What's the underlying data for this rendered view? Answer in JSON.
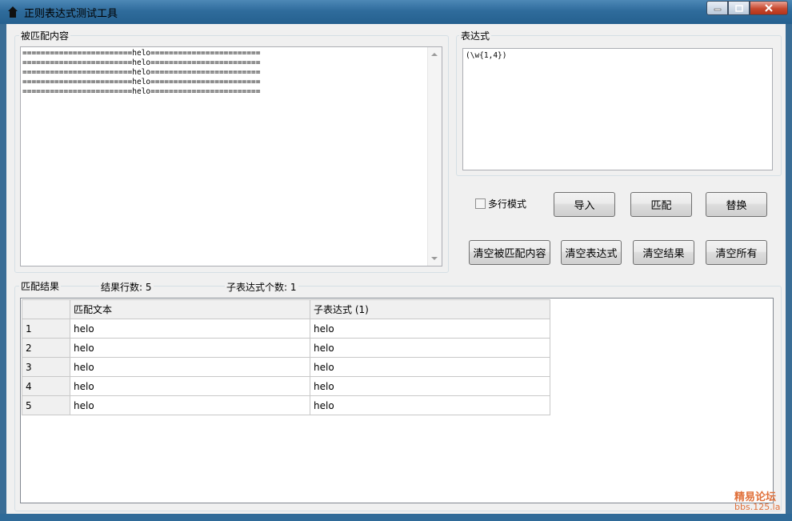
{
  "window": {
    "title": "正则表达式测试工具"
  },
  "source": {
    "label": "被匹配内容",
    "lines": [
      "========================helo========================",
      "========================helo========================",
      "========================helo========================",
      "========================helo========================",
      "========================helo========================"
    ]
  },
  "expression": {
    "label": "表达式",
    "value": "(\\w{1,4})"
  },
  "options": {
    "multiline_label": "多行模式"
  },
  "buttons": {
    "import": "导入",
    "match": "匹配",
    "replace": "替换",
    "clear_source": "清空被匹配内容",
    "clear_expr": "清空表达式",
    "clear_result": "清空结果",
    "clear_all": "清空所有"
  },
  "results": {
    "label": "匹配结果",
    "row_count_text": "结果行数: 5",
    "sub_count_text": "子表达式个数: 1",
    "columns": [
      "",
      "匹配文本",
      "子表达式 (1)"
    ],
    "rows": [
      [
        "1",
        "helo",
        "helo"
      ],
      [
        "2",
        "helo",
        "helo"
      ],
      [
        "3",
        "helo",
        "helo"
      ],
      [
        "4",
        "helo",
        "helo"
      ],
      [
        "5",
        "helo",
        "helo"
      ]
    ]
  },
  "watermark": {
    "line1": "精易论坛",
    "line2": "bbs.125.la"
  }
}
